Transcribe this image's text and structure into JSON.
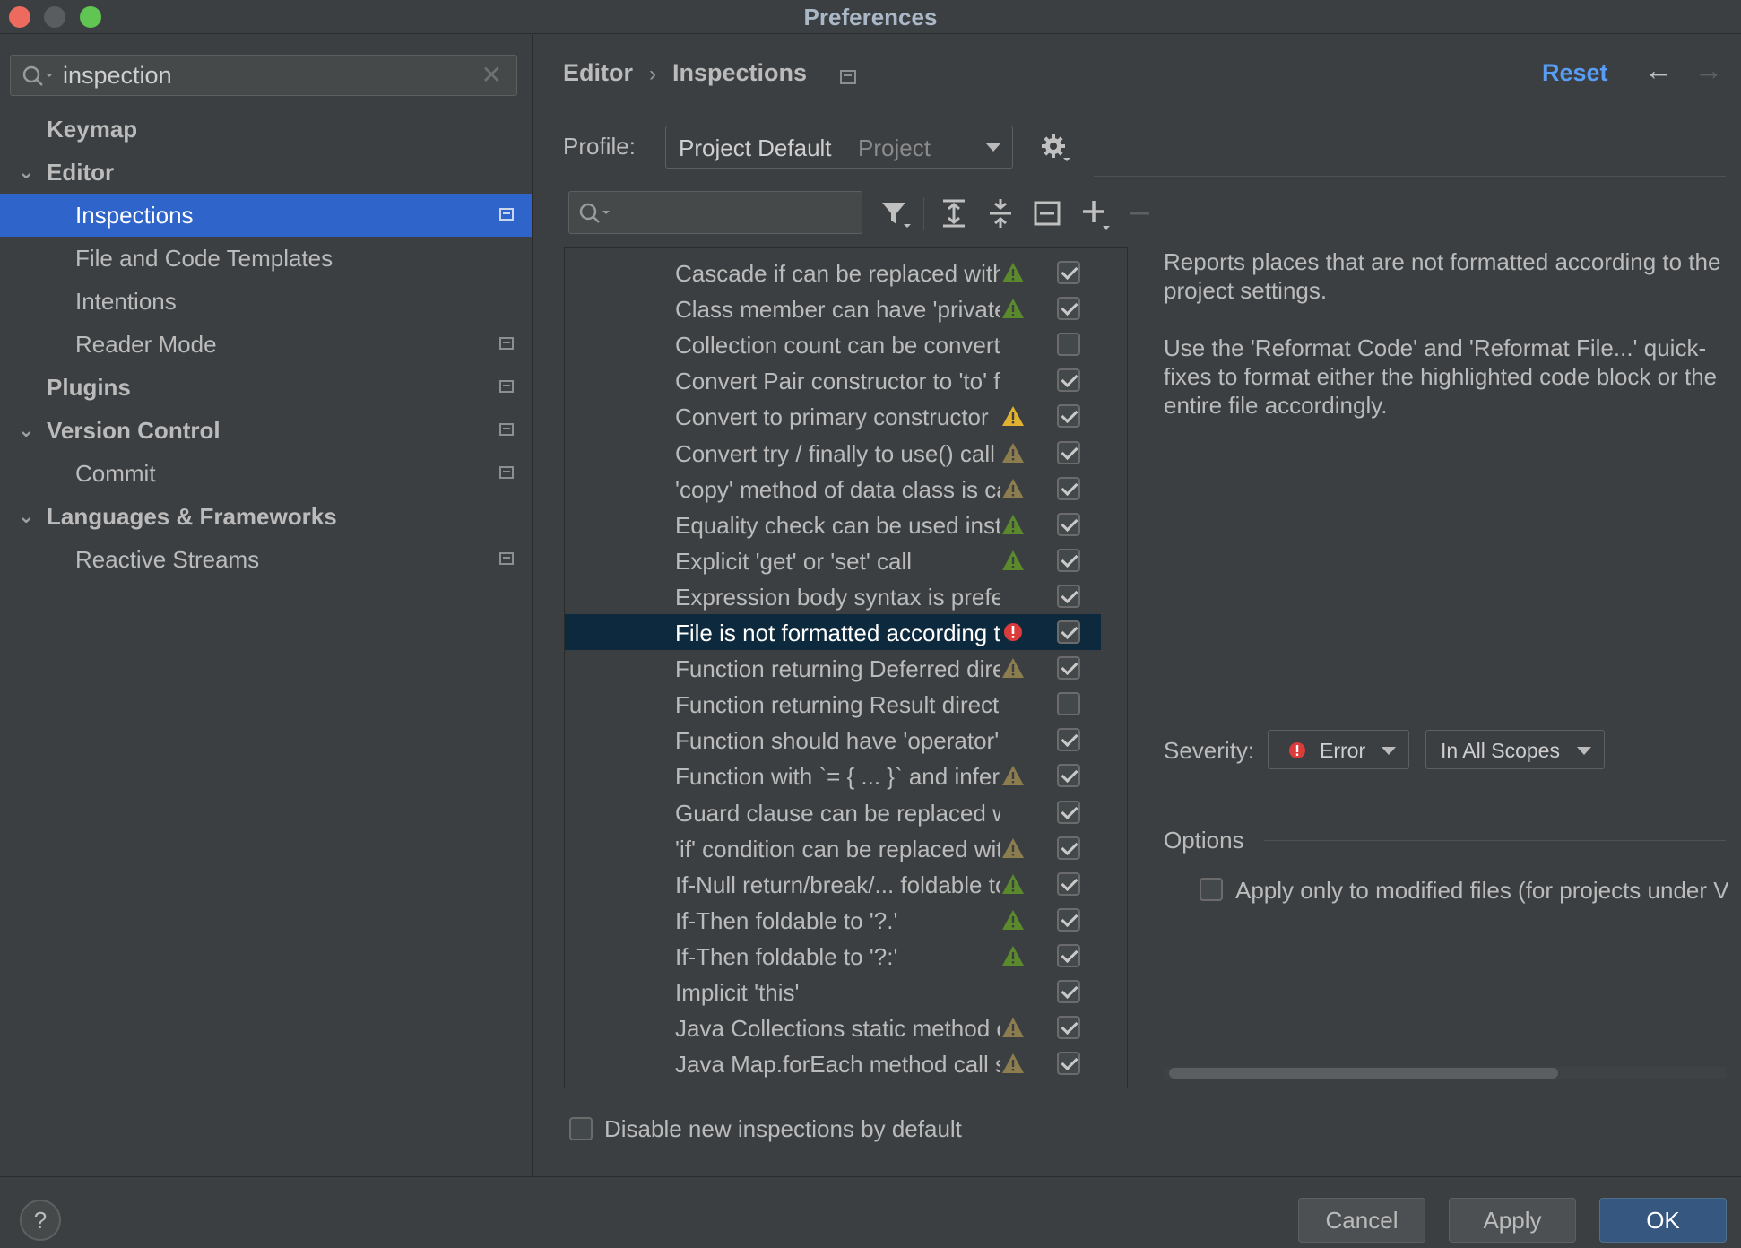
{
  "window": {
    "title": "Preferences"
  },
  "sidebar": {
    "search": {
      "value": "inspection"
    },
    "items": [
      {
        "label": "Keymap"
      },
      {
        "label": "Editor"
      },
      {
        "label": "Inspections"
      },
      {
        "label": "File and Code Templates"
      },
      {
        "label": "Intentions"
      },
      {
        "label": "Reader Mode"
      },
      {
        "label": "Plugins"
      },
      {
        "label": "Version Control"
      },
      {
        "label": "Commit"
      },
      {
        "label": "Languages & Frameworks"
      },
      {
        "label": "Reactive Streams"
      }
    ]
  },
  "header": {
    "breadcrumb": [
      "Editor",
      "Inspections"
    ],
    "breadcrumb_sep": "›",
    "reset": "Reset",
    "back_arrow": "←",
    "forward_arrow": "→"
  },
  "profile": {
    "label": "Profile:",
    "name": "Project Default",
    "scope": "Project"
  },
  "inspections": [
    {
      "label": "Cascade if can be replaced with when",
      "severity": "weak-warning",
      "checked": true
    },
    {
      "label": "Class member can have 'private' visibility",
      "severity": "weak-warning",
      "checked": true
    },
    {
      "label": "Collection count can be converted to size",
      "severity": "none",
      "checked": false
    },
    {
      "label": "Convert Pair constructor to 'to' function",
      "severity": "none",
      "checked": true
    },
    {
      "label": "Convert to primary constructor",
      "severity": "warning",
      "checked": true
    },
    {
      "label": "Convert try / finally to use() call",
      "severity": "warning-dim",
      "checked": true
    },
    {
      "label": "'copy' method of data class is called",
      "severity": "warning-dim",
      "checked": true
    },
    {
      "label": "Equality check can be used instead of 'is'",
      "severity": "weak-warning",
      "checked": true
    },
    {
      "label": "Explicit 'get' or 'set' call",
      "severity": "weak-warning",
      "checked": true
    },
    {
      "label": "Expression body syntax is preferable here",
      "severity": "none",
      "checked": true
    },
    {
      "label": "File is not formatted according to project settings",
      "severity": "error",
      "checked": true
    },
    {
      "label": "Function returning Deferred directly",
      "severity": "warning-dim",
      "checked": true
    },
    {
      "label": "Function returning Result directly",
      "severity": "none",
      "checked": false
    },
    {
      "label": "Function should have 'operator' modifier",
      "severity": "none",
      "checked": true
    },
    {
      "label": "Function with `= { ... }` and inferred return type",
      "severity": "warning-dim",
      "checked": true
    },
    {
      "label": "Guard clause can be replaced with Kotlin's function call",
      "severity": "none",
      "checked": true
    },
    {
      "label": "'if' condition can be replaced with lambda call",
      "severity": "warning-dim",
      "checked": true
    },
    {
      "label": "If-Null return/break/... foldable to '?:'",
      "severity": "weak-warning",
      "checked": true
    },
    {
      "label": "If-Then foldable to '?.'",
      "severity": "weak-warning",
      "checked": true
    },
    {
      "label": "If-Then foldable to '?:'",
      "severity": "weak-warning",
      "checked": true
    },
    {
      "label": "Implicit 'this'",
      "severity": "none",
      "checked": true
    },
    {
      "label": "Java Collections static method call can be replaced",
      "severity": "warning-dim",
      "checked": true
    },
    {
      "label": "Java Map.forEach method call should be replaced",
      "severity": "warning-dim",
      "checked": true
    }
  ],
  "description": [
    "Reports places that are not formatted according to the project settings.",
    "Use the 'Reformat Code' and 'Reformat File...' quick-fixes to format either the highlighted code block or the entire file accordingly."
  ],
  "severity": {
    "label": "Severity:",
    "value": "Error",
    "scope": "In All Scopes"
  },
  "options": {
    "label": "Options",
    "apply_modified": "Apply only to modified files (for projects under VCS)"
  },
  "disable_new": "Disable new inspections by default",
  "footer": {
    "help": "?",
    "cancel": "Cancel",
    "apply": "Apply",
    "ok": "OK"
  },
  "colors": {
    "accent": "#2f65ca",
    "link": "#589df6",
    "error": "#db3b3b",
    "warning": "#e0b22f",
    "weak_warning": "#5a8a2c",
    "ok_button": "#365880"
  }
}
